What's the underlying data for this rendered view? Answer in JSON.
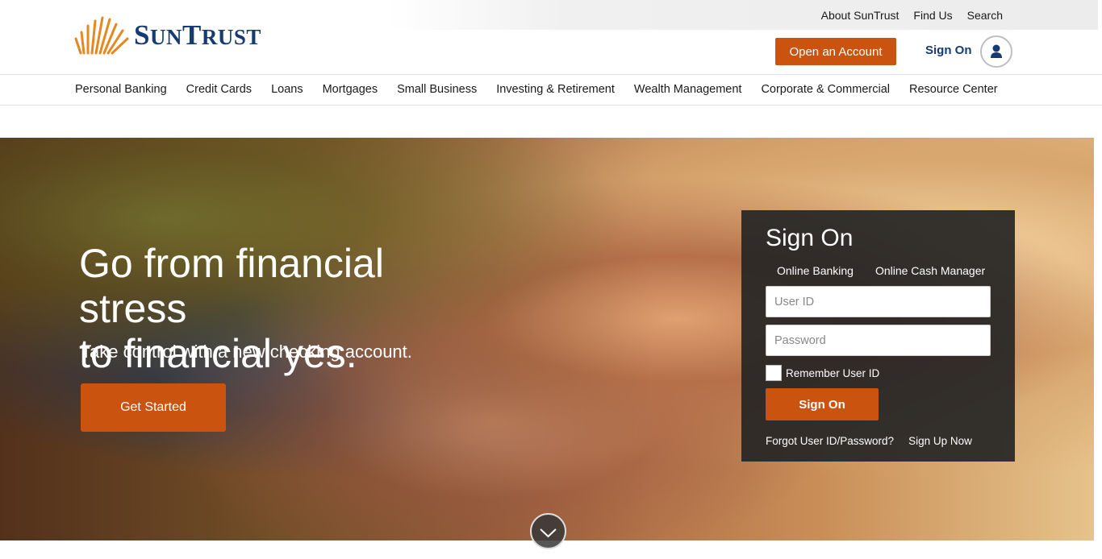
{
  "brand": {
    "name_big_s": "S",
    "name_un": "UN",
    "name_big_t": "T",
    "name_rust": "RUST",
    "logo_color": "#173a74",
    "accent": "#c9530f"
  },
  "utility_nav": [
    "About SunTrust",
    "Find Us",
    "Search"
  ],
  "header": {
    "open_account": "Open an Account",
    "sign_on": "Sign On"
  },
  "main_nav": [
    "Personal Banking",
    "Credit Cards",
    "Loans",
    "Mortgages",
    "Small Business",
    "Investing & Retirement",
    "Wealth Management",
    "Corporate & Commercial",
    "Resource Center"
  ],
  "hero": {
    "heading_line1": "Go from financial stress",
    "heading_line2": "to financial yes.",
    "subheading": "Take control with a new checking account.",
    "cta": "Get Started"
  },
  "signon_panel": {
    "title": "Sign On",
    "tabs": [
      "Online Banking",
      "Online Cash Manager"
    ],
    "user_id_placeholder": "User ID",
    "password_placeholder": "Password",
    "remember_label": "Remember User ID",
    "button": "Sign On",
    "forgot_link": "Forgot User ID/Password?",
    "signup_link": "Sign Up Now"
  }
}
